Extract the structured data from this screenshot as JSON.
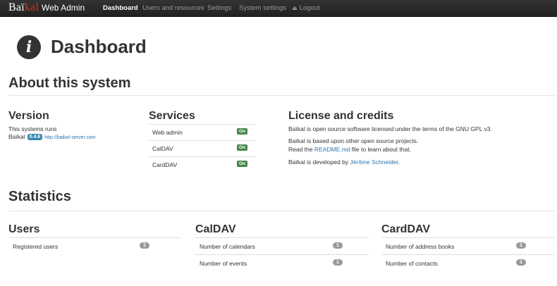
{
  "navbar": {
    "brand_logo_main": "Baï",
    "brand_logo_accent": "kal",
    "brand_text": "Web Admin",
    "items": [
      {
        "label": "Dashboard",
        "active": true
      },
      {
        "label": "Users and resources",
        "active": false
      },
      {
        "label": "Settings",
        "active": false
      },
      {
        "label": "System settings",
        "active": false
      },
      {
        "label": "Logout",
        "active": false,
        "icon": "eject-icon"
      }
    ]
  },
  "header": {
    "title": "Dashboard",
    "icon": "info-icon"
  },
  "about": {
    "title": "About this system",
    "version": {
      "title": "Version",
      "line1": "This systems runs",
      "product": "Baïkal",
      "badge": "0.4.6",
      "link": "http://baikal-server.com"
    },
    "services": {
      "title": "Services",
      "rows": [
        {
          "label": "Web admin",
          "status": "On"
        },
        {
          "label": "CalDAV",
          "status": "On"
        },
        {
          "label": "CardDAV",
          "status": "On"
        }
      ]
    },
    "license": {
      "title": "License and credits",
      "p1": "Baïkal is open source software licensed under the terms of the GNU GPL v3.",
      "p2_line1": "Baïkal is based upon other open source projects.",
      "p2_line2_pre": "Read the ",
      "p2_line2_link": "README.md",
      "p2_line2_post": " file to learn about that.",
      "p3_pre": "Baïkal is developed by ",
      "p3_link": "Jérôme Schneider",
      "p3_post": "."
    }
  },
  "statistics": {
    "title": "Statistics",
    "users": {
      "title": "Users",
      "rows": [
        {
          "label": "Registered users",
          "count": "1"
        }
      ]
    },
    "caldav": {
      "title": "CalDAV",
      "rows": [
        {
          "label": "Number of calendars",
          "count": "1"
        },
        {
          "label": "Number of events",
          "count": "1"
        }
      ]
    },
    "carddav": {
      "title": "CardDAV",
      "rows": [
        {
          "label": "Number of address books",
          "count": "1"
        },
        {
          "label": "Number of contacts",
          "count": "1"
        }
      ]
    }
  },
  "colors": {
    "navbar_bg": "#222222",
    "link": "#2a74b4",
    "on_badge": "#468847",
    "version_badge": "#3a87ad",
    "count_badge": "#999999",
    "logo_accent": "#c0392b"
  }
}
